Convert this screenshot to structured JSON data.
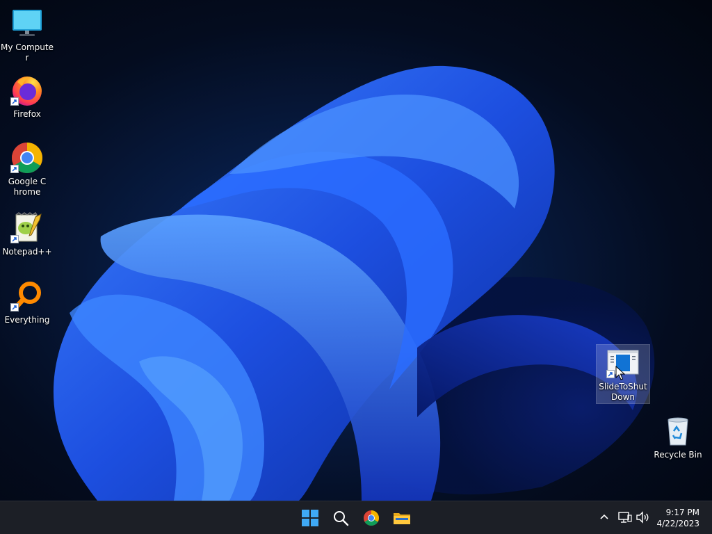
{
  "desktop": {
    "icons": [
      {
        "id": "my-computer",
        "label": "My Computer",
        "icon": "monitor-icon",
        "shortcut": false
      },
      {
        "id": "firefox",
        "label": "Firefox",
        "icon": "firefox-icon",
        "shortcut": true
      },
      {
        "id": "google-chrome",
        "label": "Google Chrome",
        "icon": "chrome-icon",
        "shortcut": true
      },
      {
        "id": "notepadpp",
        "label": "Notepad++",
        "icon": "notepadpp-icon",
        "shortcut": true
      },
      {
        "id": "everything",
        "label": "Everything",
        "icon": "magnifier-icon",
        "shortcut": true
      },
      {
        "id": "slidetoshutdown",
        "label": "SlideToShutDown",
        "icon": "slide-window-icon",
        "shortcut": true,
        "selected": true
      },
      {
        "id": "recycle-bin",
        "label": "Recycle Bin",
        "icon": "recycle-bin-icon",
        "shortcut": false
      }
    ]
  },
  "taskbar": {
    "pinned": [
      {
        "id": "start",
        "icon": "windows-logo-icon"
      },
      {
        "id": "search",
        "icon": "search-icon"
      },
      {
        "id": "chrome",
        "icon": "chrome-icon"
      },
      {
        "id": "file-explorer",
        "icon": "folder-icon"
      }
    ],
    "tray": [
      {
        "id": "show-hidden",
        "icon": "chevron-up-icon"
      },
      {
        "id": "network",
        "icon": "network-icon"
      },
      {
        "id": "volume",
        "icon": "speaker-icon"
      }
    ],
    "clock": {
      "time": "9:17 PM",
      "date": "4/22/2023"
    }
  },
  "colors": {
    "taskbar": "#1c1f26",
    "wallpaper_accent": "#1f5cff",
    "windows_blue": "#3fa9f5"
  }
}
